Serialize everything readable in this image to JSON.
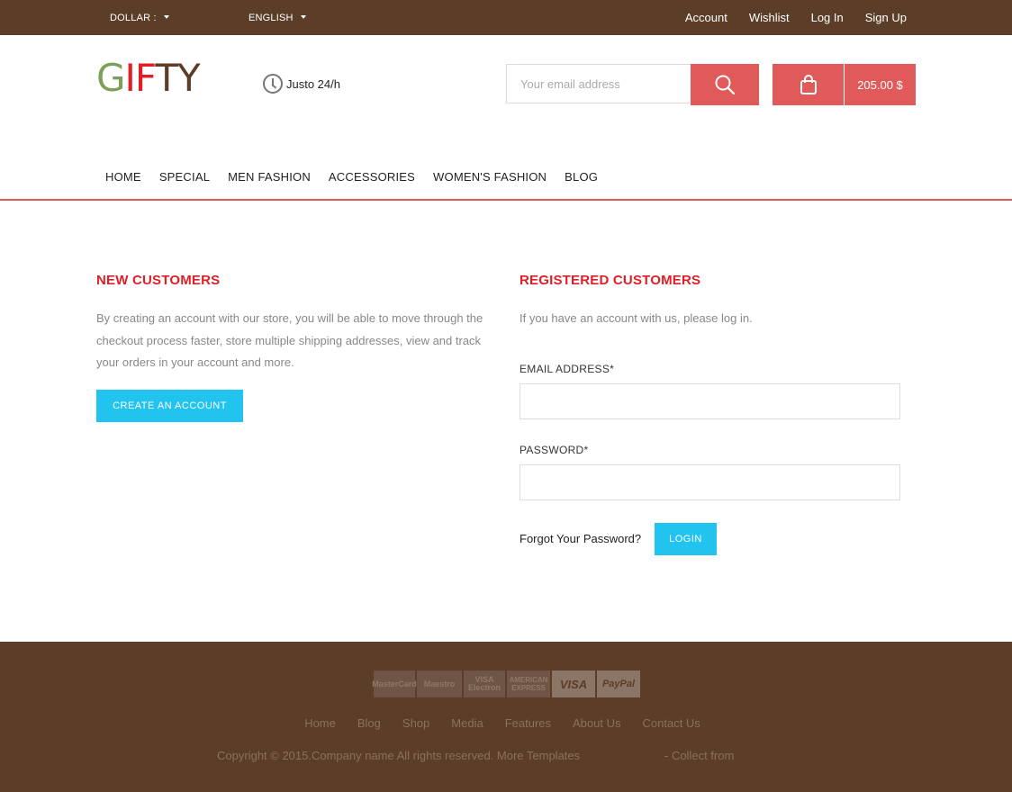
{
  "topbar": {
    "currency": "DOLLAR :",
    "language": "ENGLISH",
    "links": [
      "Account",
      "Wishlist",
      "Log In",
      "Sign Up"
    ]
  },
  "header": {
    "logo_g": "G",
    "logo_if": "IF",
    "logo_ty": "TY",
    "hours": "Justo 24/h",
    "search_placeholder": "Your email address",
    "cart_total": "205.00 $"
  },
  "nav": {
    "items": [
      "HOME",
      "SPECIAL",
      "MEN FASHION",
      "ACCESSORIES",
      "WOMEN'S FASHION",
      "BLOG"
    ]
  },
  "new_customers": {
    "title": "NEW CUSTOMERS",
    "description": "By creating an account with our store, you will be able to move through the checkout process faster, store multiple shipping addresses, view and track your orders in your account and more.",
    "button": "CREATE AN ACCOUNT"
  },
  "registered_customers": {
    "title": "REGISTERED CUSTOMERS",
    "description": "If you have an account with us, please log in.",
    "email_label": "EMAIL ADDRESS*",
    "password_label": "PASSWORD*",
    "forgot": "Forgot Your Password?",
    "login_button": "LOGIN"
  },
  "footer": {
    "payments": [
      "MasterCard",
      "Maestro",
      "VISA Electron",
      "AMERICAN EXPRESS",
      "VISA",
      "PayPal"
    ],
    "links": [
      "Home",
      "Blog",
      "Shop",
      "Media",
      "Features",
      "About Us",
      "Contact Us"
    ],
    "copyright": "Copyright © 2015.Company name All rights reserved. More Templates",
    "collect": "- Collect from"
  },
  "colors": {
    "brand_brown": "#5b3d28",
    "accent_red": "#e05a5a",
    "title_red": "#e01e26",
    "button_blue": "#22c3ee"
  }
}
